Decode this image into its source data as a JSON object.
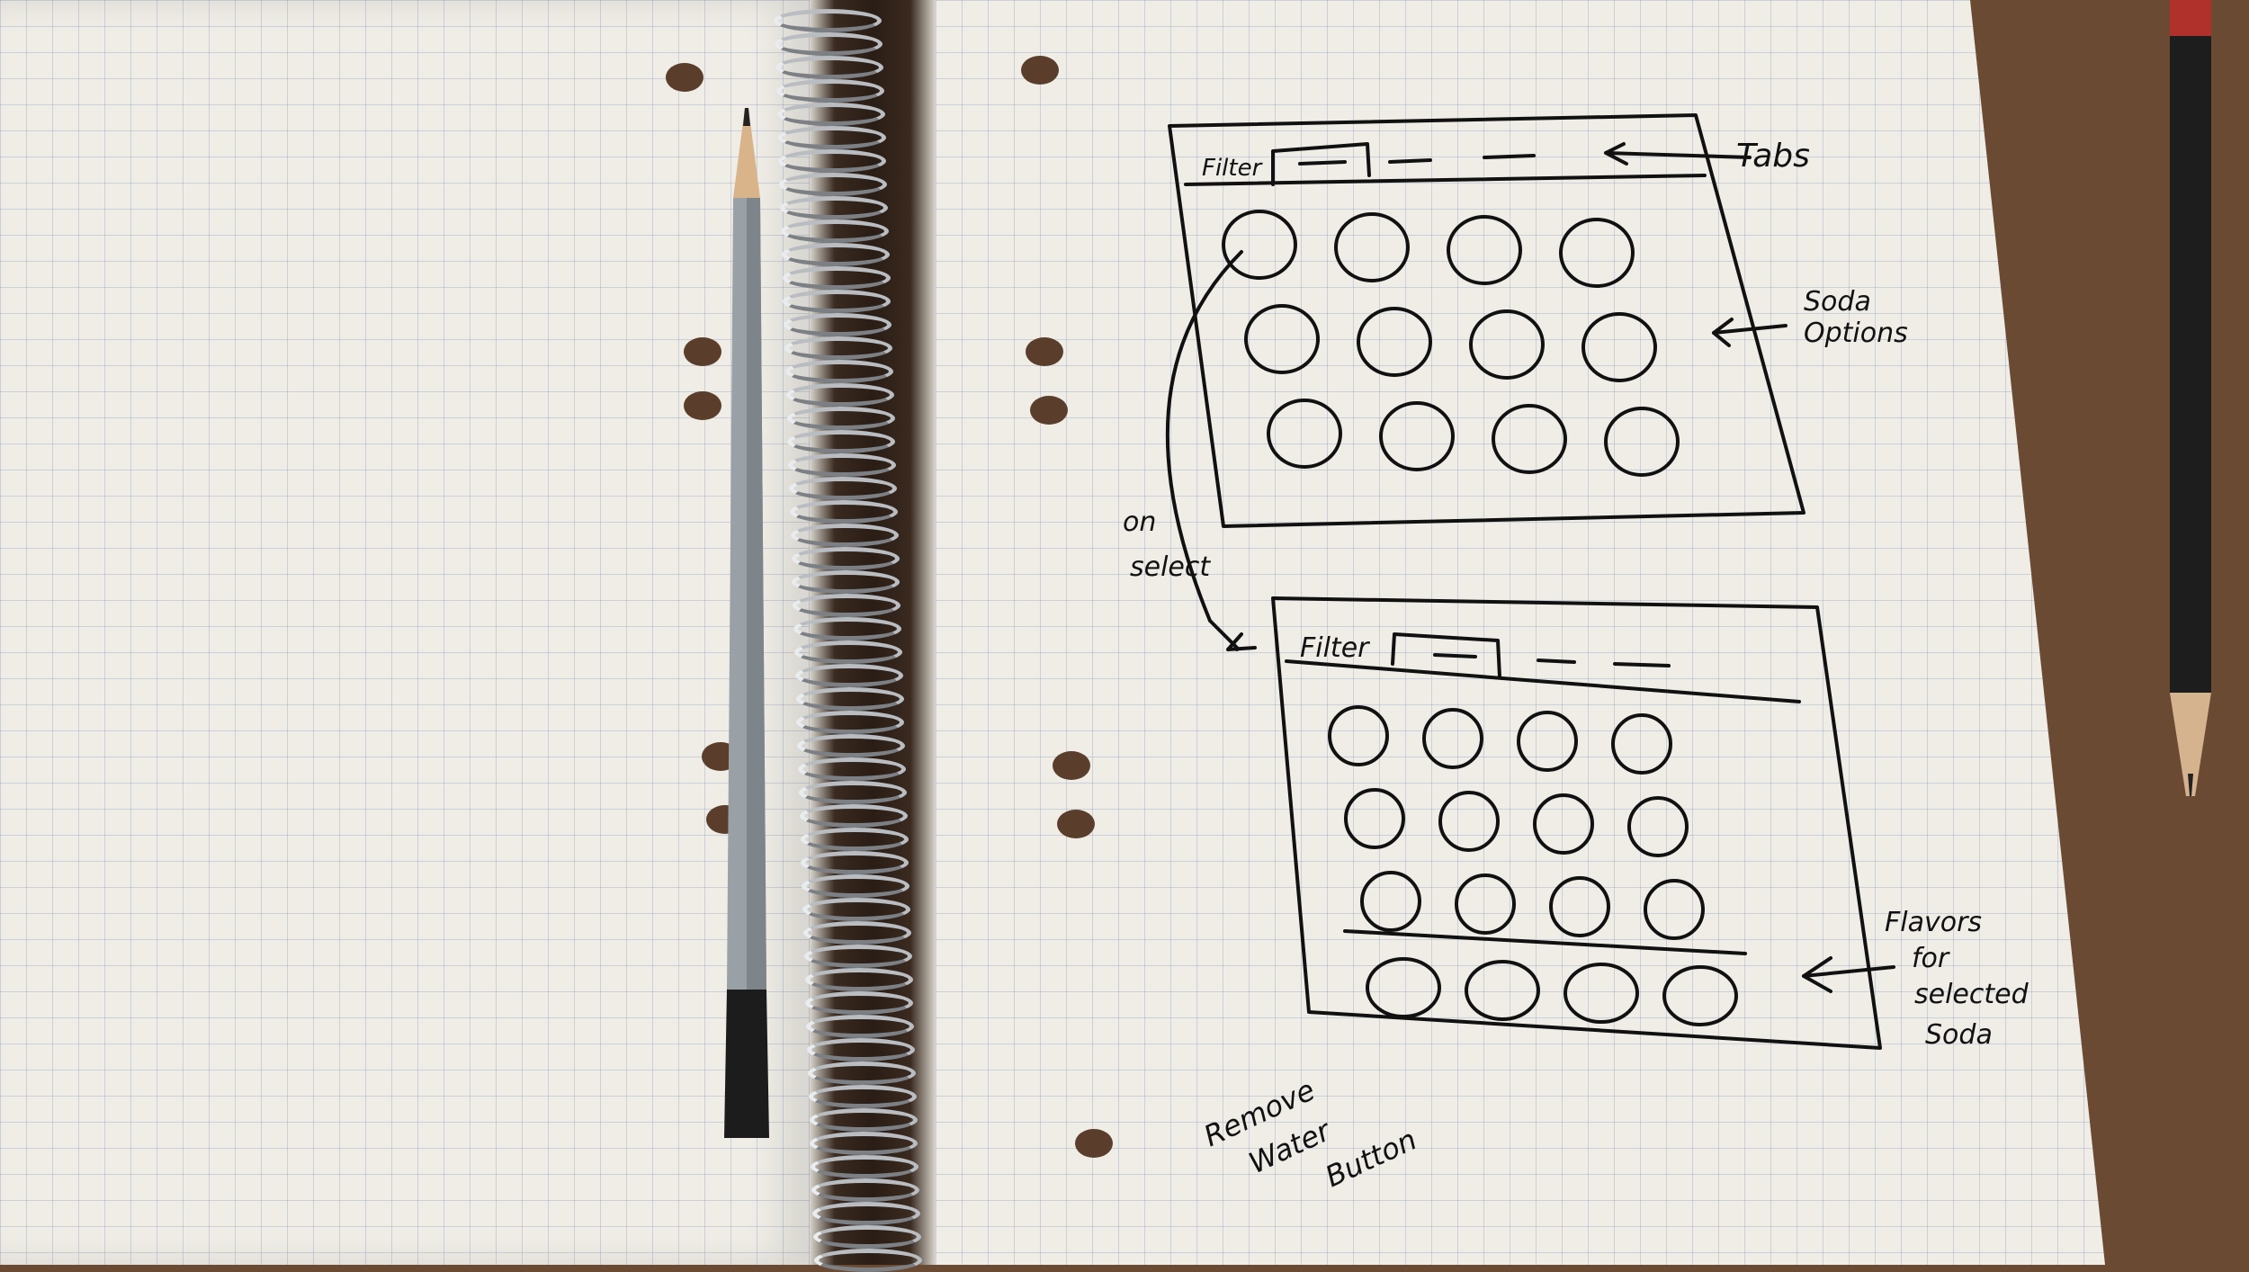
{
  "sketch": {
    "screen1": {
      "tab_label": "Filter",
      "bubble_rows": [
        4,
        4,
        4
      ]
    },
    "screen2": {
      "tab_label": "Filter",
      "bubble_rows": [
        4,
        4,
        4
      ],
      "flavor_row": 4
    },
    "annotations": {
      "tabs": "Tabs",
      "soda_options": [
        "Soda",
        "Options"
      ],
      "on_select": [
        "on",
        "select"
      ],
      "flavors": [
        "Flavors",
        "for",
        "selected",
        "Soda"
      ],
      "remove_water": [
        "Remove",
        "Water",
        "Button"
      ]
    }
  },
  "colors": {
    "ink": "#111111",
    "paper": "#efede6",
    "grid": "#8296be",
    "desk": "#6b4a33"
  }
}
